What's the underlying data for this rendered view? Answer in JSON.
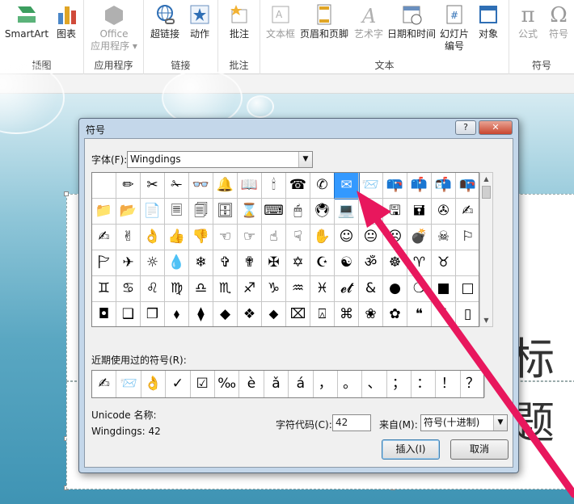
{
  "ribbon": {
    "groups": [
      {
        "label": "插图",
        "buttons": [
          "SmartArt",
          "图表"
        ]
      },
      {
        "label": "应用程序",
        "buttons": [
          "Office\n应用程序 ▾"
        ]
      },
      {
        "label": "链接",
        "buttons": [
          "超链接",
          "动作"
        ]
      },
      {
        "label": "批注",
        "buttons": [
          "批注"
        ]
      },
      {
        "label": "文本",
        "buttons": [
          "文本框",
          "页眉和页脚",
          "艺术字",
          "日期和时间",
          "幻灯片\n编号",
          "对象"
        ]
      },
      {
        "label": "符号",
        "buttons": [
          "公式",
          "符号"
        ]
      }
    ],
    "b_smartart": "SmartArt",
    "b_chart": "图表",
    "b_office1": "Office",
    "b_office2": "应用程序 ▾",
    "b_hyperlink": "超链接",
    "b_action": "动作",
    "b_comment": "批注",
    "b_textbox": "文本框",
    "b_header": "页眉和页脚",
    "b_wordart": "艺术字",
    "b_datetime": "日期和时间",
    "b_slideno1": "幻灯片",
    "b_slideno2": "编号",
    "b_object": "对象",
    "b_equation": "公式",
    "b_symbol": "符号",
    "g_illus": "插图",
    "g_apps": "应用程序",
    "g_links": "链接",
    "g_comments": "批注",
    "g_text": "文本",
    "g_symbols": "符号",
    "equation_glyph": "π",
    "symbol_glyph": "Ω"
  },
  "slide": {
    "title_fragment": "标题"
  },
  "dialog": {
    "title": "符号",
    "help_button": "?",
    "close_button": "✕",
    "font_label": "字体(F):",
    "font_value": "Wingdings",
    "symbols": [
      "",
      "✏",
      "✂",
      "✁",
      "👓",
      "🔔",
      "📖",
      "🕯",
      "☎",
      "✆",
      "✉",
      "📨",
      "📪",
      "📫",
      "📬",
      "📭",
      "📁",
      "📂",
      "📄",
      "🗏",
      "🗐",
      "🗄",
      "⌛",
      "⌨",
      "🖱",
      "🖲",
      "💻",
      "🖴",
      "🖫",
      "🖬",
      "✇",
      "✍",
      "✍",
      "✌",
      "👌",
      "👍",
      "👎",
      "☜",
      "☞",
      "☝",
      "☟",
      "✋",
      "☺",
      "😐",
      "☹",
      "💣",
      "☠",
      "⚐",
      "🏱",
      "✈",
      "☼",
      "💧",
      "❄",
      "✞",
      "✟",
      "✠",
      "✡",
      "☪",
      "☯",
      "ॐ",
      "☸",
      "♈",
      "♉",
      "",
      "♊",
      "♋",
      "♌",
      "♍",
      "♎",
      "♏",
      "♐",
      "♑",
      "♒",
      "♓",
      "𝓮𝓽",
      "&",
      "●",
      "❍",
      "■",
      "□",
      "◘",
      "❑",
      "❒",
      "⬧",
      "⧫",
      "◆",
      "❖",
      "⬥",
      "⌧",
      "⍓",
      "⌘",
      "❀",
      "✿",
      "❝",
      "❞",
      "▯"
    ],
    "recent_label": "近期使用过的符号(R):",
    "recent": [
      "✍",
      "📨",
      "👌",
      "✓",
      "☑",
      "‰",
      "è",
      "ǎ",
      "á",
      "，",
      "。",
      "、",
      "；",
      "：",
      "！",
      "？"
    ],
    "unicode_name_label": "Unicode 名称:",
    "unicode_name_value": "Wingdings: 42",
    "char_code_label": "字符代码(C):",
    "char_code_value": "42",
    "from_label": "来自(M):",
    "from_value": "符号(十进制)",
    "insert_button": "插入(I)",
    "cancel_button": "取消"
  },
  "colors": {
    "selection": "#3399ff",
    "arrow": "#e8175d"
  }
}
